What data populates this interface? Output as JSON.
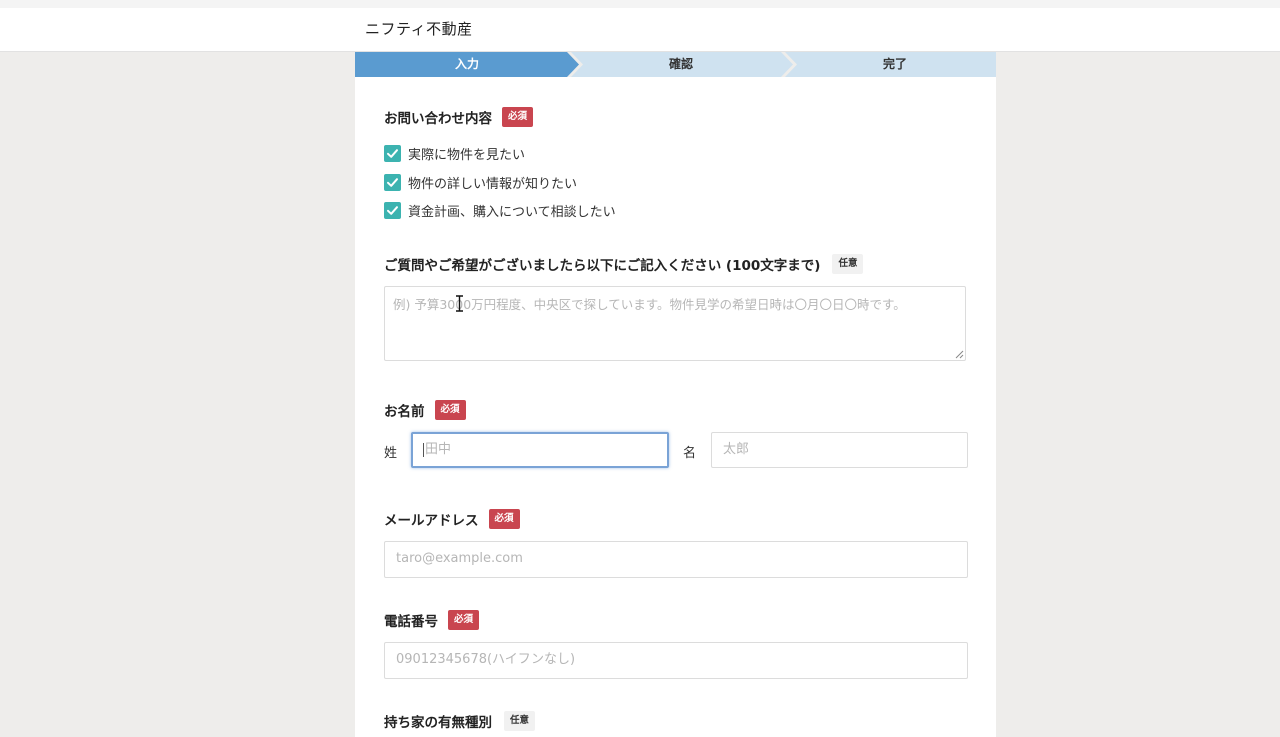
{
  "header": {
    "site_name": "ニフティ不動産"
  },
  "steps": [
    {
      "label": "入力",
      "state": "active"
    },
    {
      "label": "確認",
      "state": "inactive"
    },
    {
      "label": "完了",
      "state": "inactive"
    }
  ],
  "colors": {
    "step_active": "#5a9bd0",
    "step_inactive": "#cfe2f0",
    "required_badge": "#c9454f",
    "checkbox": "#3cb3b0",
    "focus_border": "#7aa3d6",
    "page_bg": "#eeedeb"
  },
  "inquiry": {
    "title": "お問い合わせ内容",
    "badge": "必須",
    "options": [
      {
        "label": "実際に物件を見たい",
        "checked": true
      },
      {
        "label": "物件の詳しい情報が知りたい",
        "checked": true
      },
      {
        "label": "資金計画、購入について相談したい",
        "checked": true
      }
    ]
  },
  "question": {
    "title": "ご質問やご希望がございましたら以下にご記入ください (100文字まで)",
    "badge": "任意",
    "placeholder": "例) 予算3000万円程度、中央区で探しています。物件見学の希望日時は〇月〇日〇時です。"
  },
  "name": {
    "title": "お名前",
    "badge": "必須",
    "last_label": "姓",
    "last_placeholder": "田中",
    "first_label": "名",
    "first_placeholder": "太郎"
  },
  "email": {
    "title": "メールアドレス",
    "badge": "必須",
    "placeholder": "taro@example.com"
  },
  "phone": {
    "title": "電話番号",
    "badge": "必須",
    "placeholder": "09012345678(ハイフンなし)"
  },
  "next_section": {
    "title": "持ち家の有無種別",
    "badge": "任意"
  }
}
